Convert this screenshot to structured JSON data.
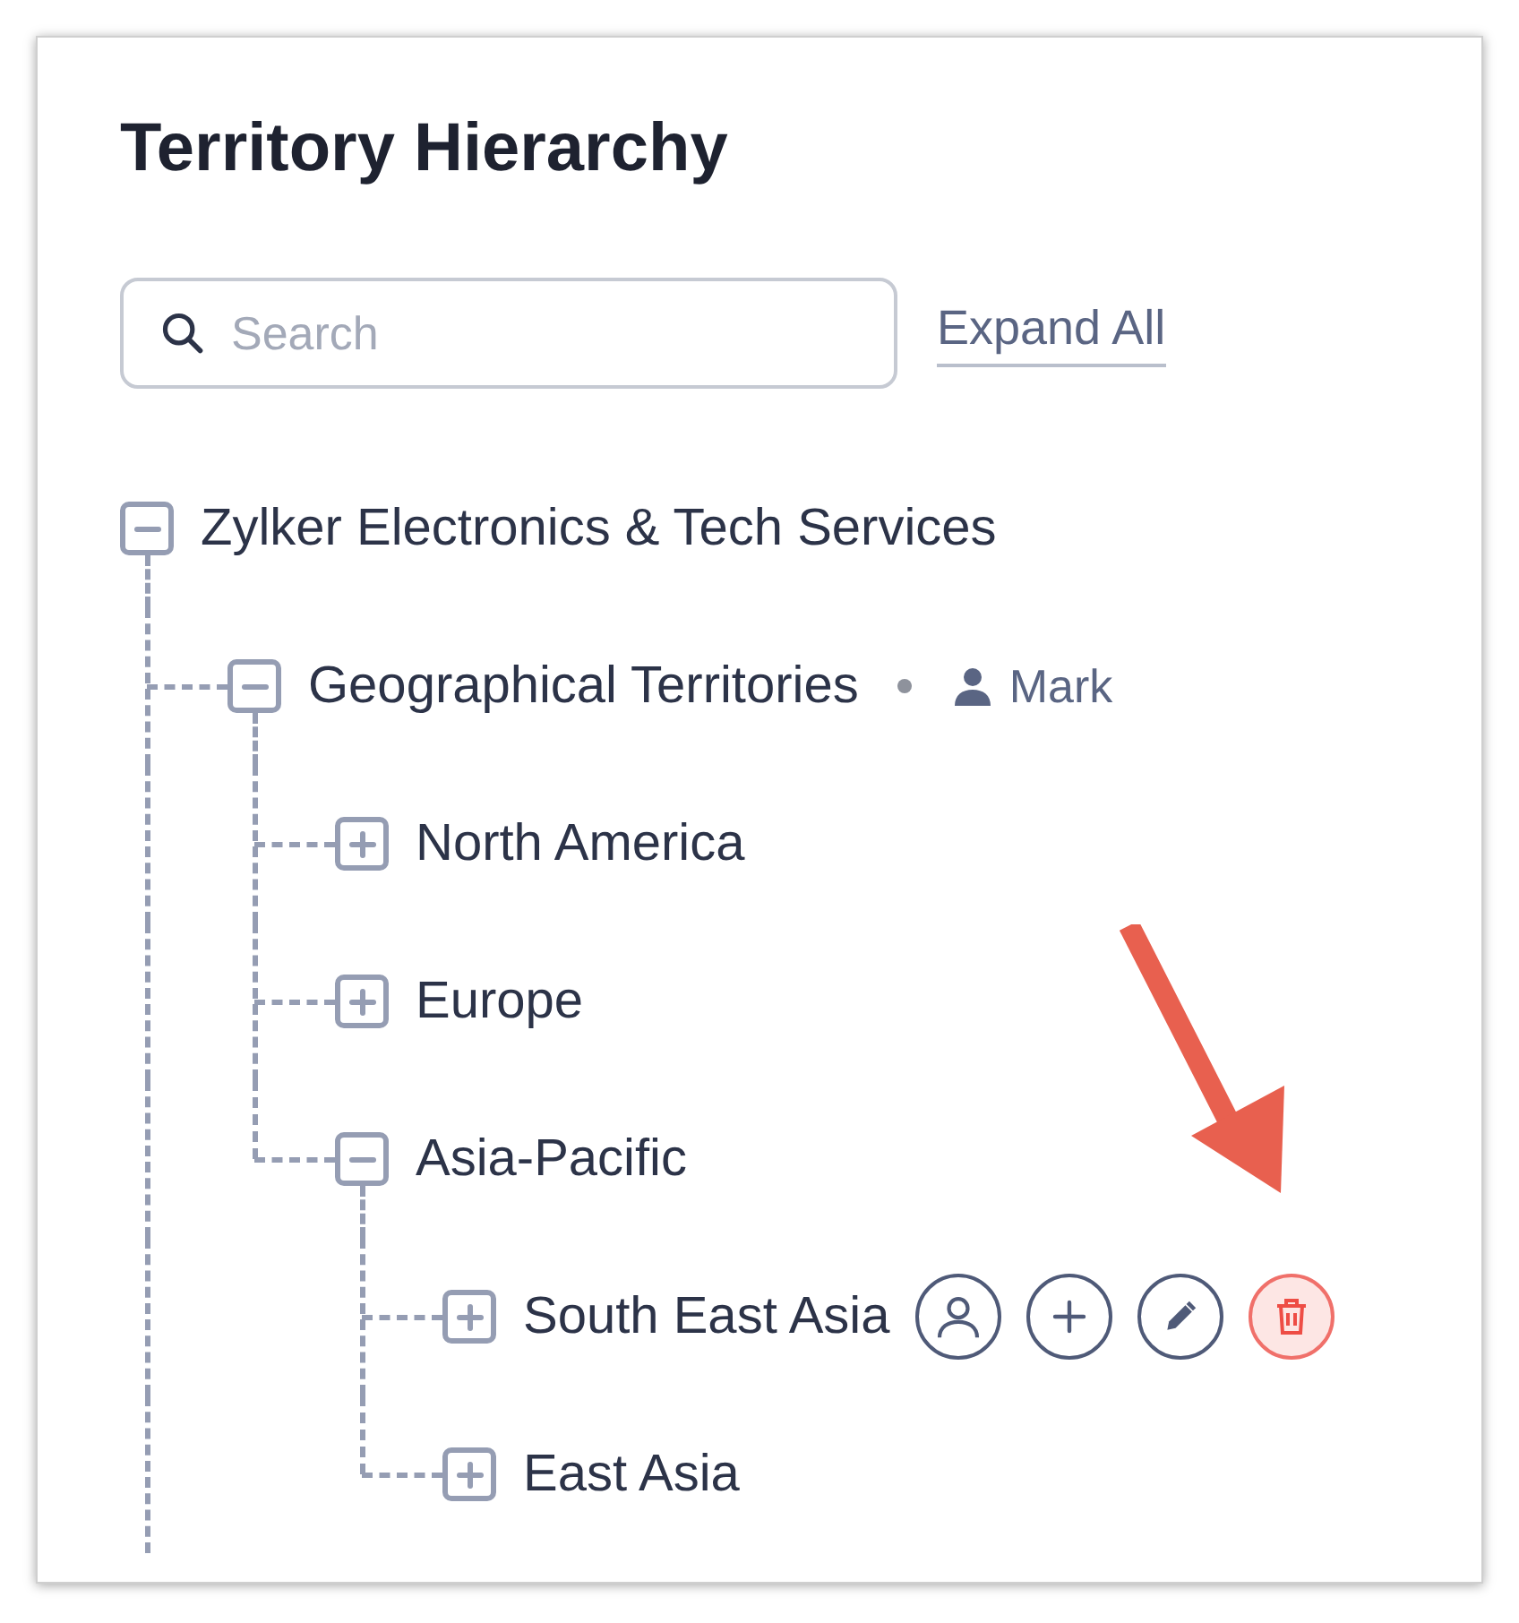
{
  "title": "Territory Hierarchy",
  "search": {
    "placeholder": "Search"
  },
  "expand_all": "Expand All",
  "tree": [
    {
      "label": "Zylker Electronics & Tech Services",
      "expanded": true,
      "continues_below": true,
      "children": [
        {
          "label": "Geographical Territories",
          "expanded": true,
          "owner": "Mark",
          "children": [
            {
              "label": "North America",
              "expanded": false
            },
            {
              "label": "Europe",
              "expanded": false
            },
            {
              "label": "Asia-Pacific",
              "expanded": true,
              "children": [
                {
                  "label": "South East Asia",
                  "expanded": false,
                  "actions": [
                    {
                      "kind": "user",
                      "highlighted": false
                    },
                    {
                      "kind": "add",
                      "highlighted": false
                    },
                    {
                      "kind": "edit",
                      "highlighted": false
                    },
                    {
                      "kind": "delete",
                      "highlighted": true
                    }
                  ]
                },
                {
                  "label": "East Asia",
                  "expanded": false
                }
              ]
            }
          ]
        }
      ]
    }
  ]
}
